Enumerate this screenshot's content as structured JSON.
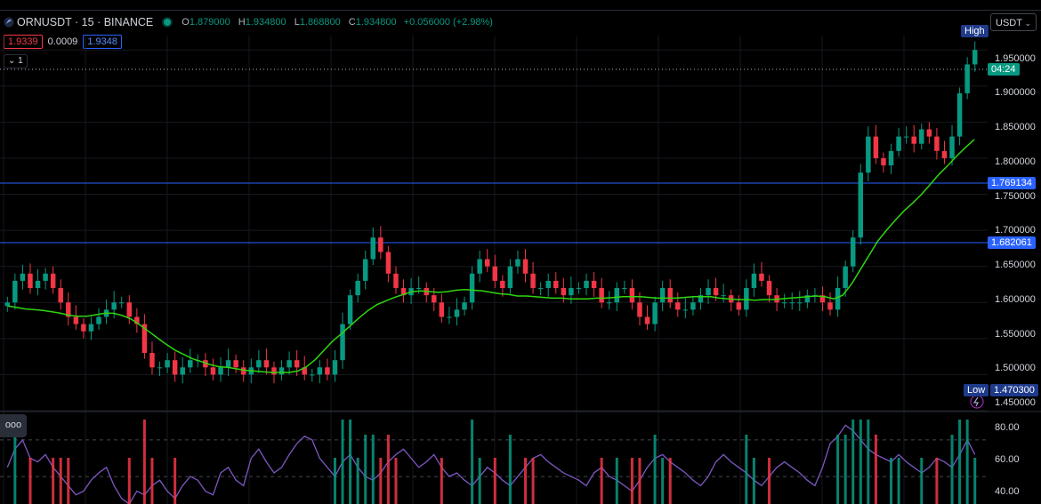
{
  "header": {
    "symbol": "ORNUSDT · 15 · BINANCE",
    "o_key": "O",
    "o_val": "1.879000",
    "h_key": "H",
    "h_val": "1.934800",
    "l_key": "L",
    "l_val": "1.868800",
    "c_key": "C",
    "c_val": "1.934800",
    "change": "+0.056000 (+2.98%)"
  },
  "quote": {
    "bid": "1.9339",
    "spread": "0.0009",
    "ask": "1.9348"
  },
  "collapse_label": "1",
  "currency": "USDT",
  "menu_label": "ooo",
  "price_axis": {
    "ticks": [
      "1.950000",
      "1.900000",
      "1.850000",
      "1.800000",
      "1.750000",
      "1.700000",
      "1.650000",
      "1.600000",
      "1.550000",
      "1.500000",
      "1.450000"
    ],
    "high_label": "High",
    "low_label": "Low",
    "low_value": "1.470300",
    "countdown": "04:24",
    "hline1_value": "1.769134",
    "hline2_value": "1.682061"
  },
  "rsi_axis": {
    "ticks": [
      "80.00",
      "60.00",
      "40.00"
    ]
  },
  "colors": {
    "up": "#089981",
    "down": "#f23645",
    "ma": "#2fd60f",
    "rsi": "#7e57c2",
    "hline": "#2962ff",
    "label_bg": "#2962ff",
    "countdown_bg": "#089981"
  },
  "chart_data": {
    "type": "candlestick",
    "price_range": [
      1.45,
      1.97
    ],
    "rsi_range": [
      35,
      85
    ],
    "horizontal_lines": [
      1.769134,
      1.682061
    ],
    "close": [
      1.6,
      1.63,
      1.64,
      1.62,
      1.63,
      1.64,
      1.62,
      1.6,
      1.58,
      1.57,
      1.56,
      1.57,
      1.58,
      1.59,
      1.6,
      1.6,
      1.58,
      1.57,
      1.53,
      1.51,
      1.51,
      1.52,
      1.5,
      1.51,
      1.52,
      1.52,
      1.51,
      1.5,
      1.51,
      1.52,
      1.51,
      1.5,
      1.51,
      1.52,
      1.51,
      1.5,
      1.51,
      1.52,
      1.51,
      1.5,
      1.5,
      1.51,
      1.5,
      1.52,
      1.57,
      1.61,
      1.63,
      1.66,
      1.69,
      1.67,
      1.64,
      1.62,
      1.61,
      1.62,
      1.62,
      1.61,
      1.6,
      1.58,
      1.58,
      1.59,
      1.6,
      1.64,
      1.66,
      1.65,
      1.63,
      1.62,
      1.65,
      1.66,
      1.64,
      1.62,
      1.62,
      1.63,
      1.62,
      1.61,
      1.62,
      1.62,
      1.63,
      1.62,
      1.6,
      1.6,
      1.62,
      1.62,
      1.6,
      1.58,
      1.57,
      1.6,
      1.62,
      1.6,
      1.59,
      1.59,
      1.6,
      1.61,
      1.62,
      1.61,
      1.61,
      1.6,
      1.59,
      1.62,
      1.64,
      1.63,
      1.61,
      1.6,
      1.6,
      1.6,
      1.6,
      1.61,
      1.61,
      1.6,
      1.59,
      1.62,
      1.65,
      1.69,
      1.78,
      1.83,
      1.8,
      1.79,
      1.81,
      1.83,
      1.83,
      1.82,
      1.84,
      1.83,
      1.81,
      1.8,
      1.83,
      1.89,
      1.93,
      1.95
    ],
    "ma": [
      1.595,
      1.593,
      1.591,
      1.59,
      1.589,
      1.587,
      1.585,
      1.582,
      1.581,
      1.581,
      1.583,
      1.585,
      1.585,
      1.582,
      1.577,
      1.569,
      1.56,
      1.551,
      1.542,
      1.534,
      1.528,
      1.522,
      1.518,
      1.514,
      1.511,
      1.51,
      1.508,
      1.506,
      1.505,
      1.504,
      1.503,
      1.503,
      1.503,
      1.505,
      1.511,
      1.521,
      1.534,
      1.547,
      1.557,
      1.568,
      1.579,
      1.589,
      1.597,
      1.602,
      1.607,
      1.611,
      1.615,
      1.616,
      1.615,
      1.614,
      1.615,
      1.617,
      1.618,
      1.617,
      1.616,
      1.614,
      1.612,
      1.611,
      1.609,
      1.609,
      1.608,
      1.607,
      1.606,
      1.606,
      1.605,
      1.605,
      1.605,
      1.606,
      1.606,
      1.607,
      1.608,
      1.608,
      1.608,
      1.607,
      1.606,
      1.606,
      1.606,
      1.607,
      1.608,
      1.608,
      1.608,
      1.606,
      1.605,
      1.604,
      1.604,
      1.603,
      1.604,
      1.604,
      1.605,
      1.606,
      1.607,
      1.608,
      1.609,
      1.608,
      1.605,
      1.61,
      1.625,
      1.645,
      1.665,
      1.685,
      1.7,
      1.714,
      1.727,
      1.738,
      1.75,
      1.764,
      1.778,
      1.79,
      1.803,
      1.815,
      1.826
    ],
    "rsi": [
      55,
      65,
      70,
      60,
      58,
      62,
      55,
      50,
      45,
      40,
      42,
      48,
      52,
      55,
      45,
      38,
      35,
      42,
      40,
      45,
      48,
      42,
      38,
      45,
      50,
      48,
      42,
      40,
      52,
      55,
      48,
      45,
      60,
      65,
      58,
      52,
      55,
      62,
      68,
      72,
      70,
      60,
      55,
      50,
      58,
      62,
      55,
      50,
      48,
      52,
      58,
      62,
      65,
      60,
      55,
      58,
      62,
      55,
      50,
      52,
      48,
      45,
      50,
      55,
      52,
      48,
      45,
      50,
      55,
      60,
      62,
      58,
      55,
      52,
      50,
      48,
      45,
      52,
      55,
      50,
      48,
      45,
      42,
      48,
      55,
      60,
      62,
      58,
      55,
      52,
      48,
      45,
      50,
      58,
      62,
      58,
      55,
      52,
      48,
      45,
      50,
      55,
      58,
      55,
      52,
      48,
      45,
      55,
      68,
      72,
      78,
      75,
      70,
      65,
      62,
      60,
      58,
      62,
      58,
      55,
      52,
      55,
      60,
      58,
      55,
      62,
      70,
      62
    ]
  }
}
